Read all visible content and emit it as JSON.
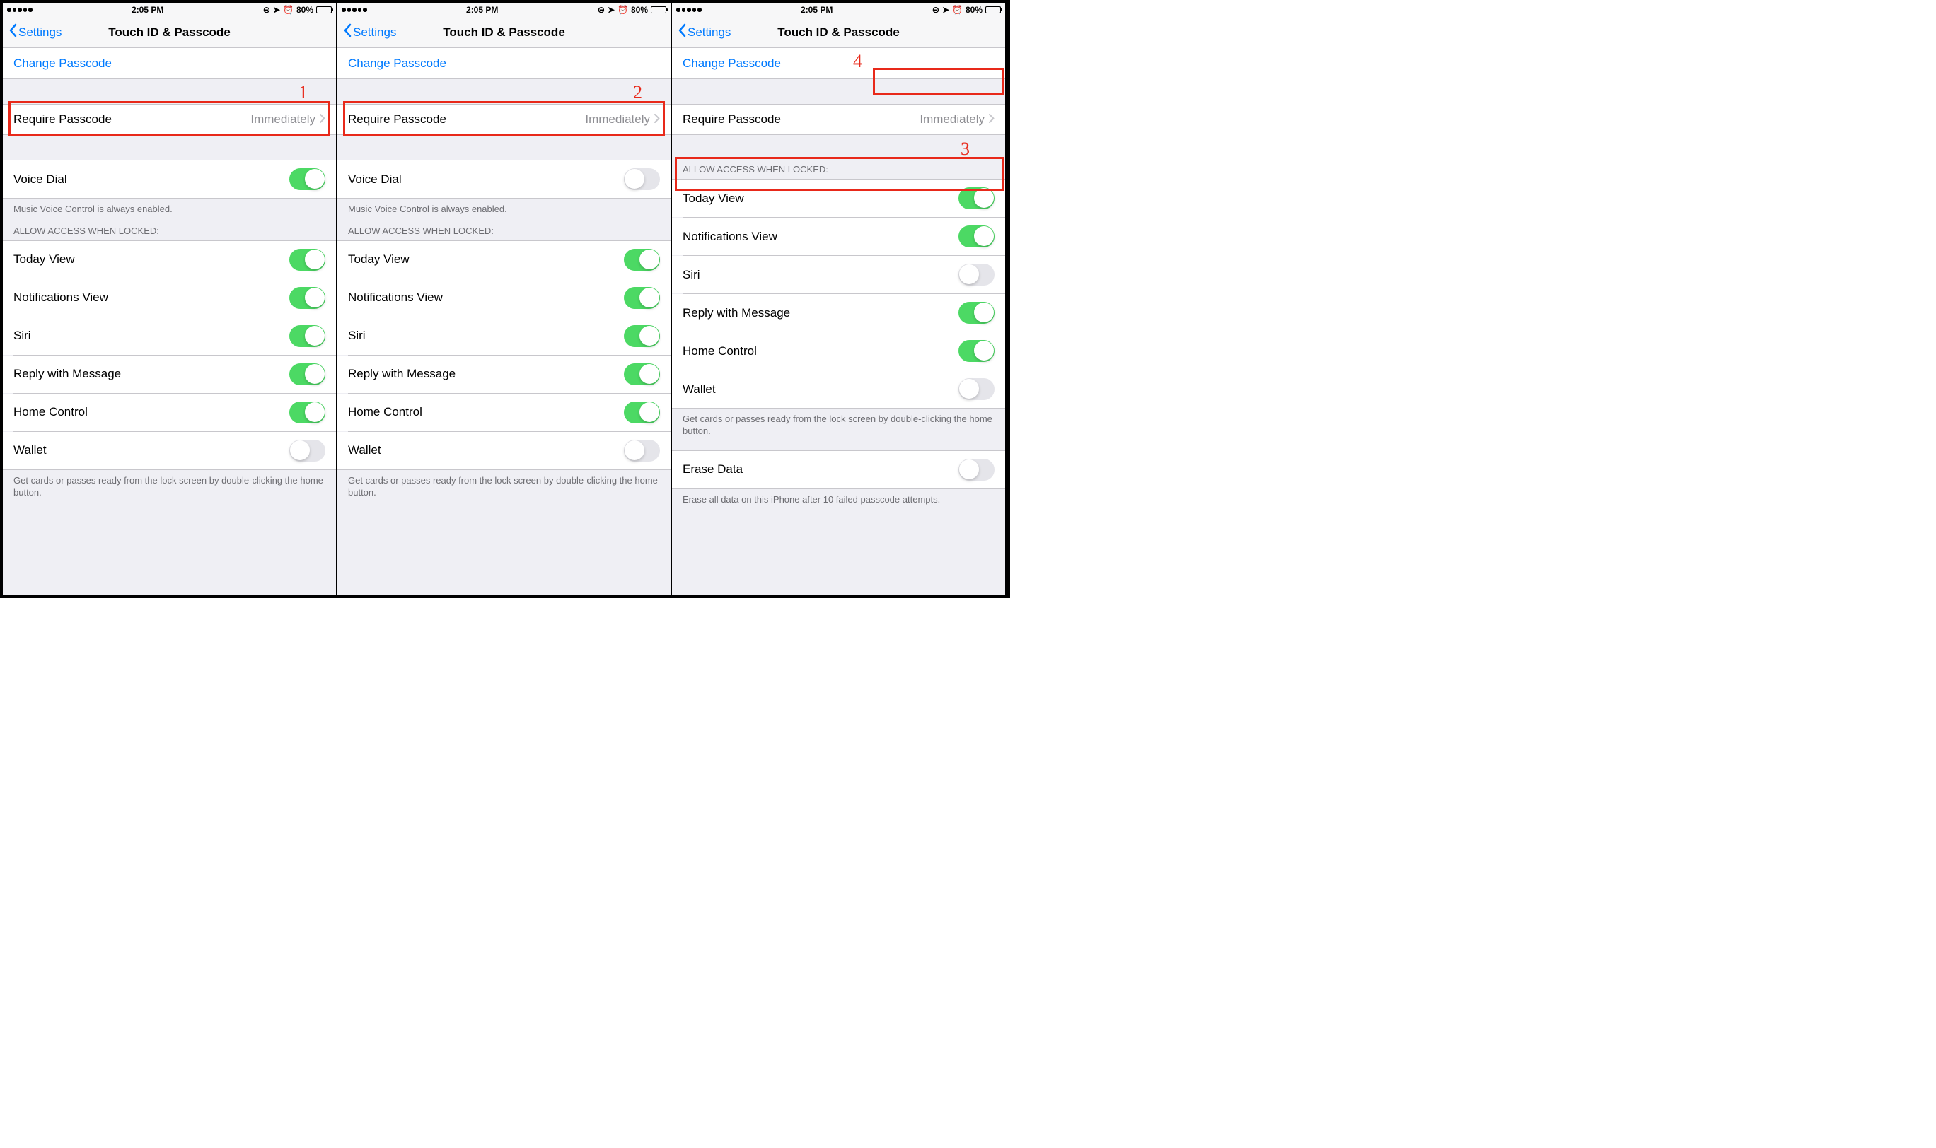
{
  "status": {
    "time": "2:05 PM",
    "battery_pct": "80%"
  },
  "nav": {
    "back_label": "Settings",
    "title": "Touch ID & Passcode"
  },
  "labels": {
    "change_passcode": "Change Passcode",
    "require_passcode": "Require Passcode",
    "require_passcode_value": "Immediately",
    "voice_dial": "Voice Dial",
    "voice_dial_footer": "Music Voice Control is always enabled.",
    "allow_access_header": "ALLOW ACCESS WHEN LOCKED:",
    "wallet_footer": "Get cards or passes ready from the lock screen by double-clicking the home button.",
    "erase_data": "Erase Data",
    "erase_data_footer": "Erase all data on this iPhone after 10 failed passcode attempts."
  },
  "access_items": [
    {
      "label": "Today View"
    },
    {
      "label": "Notifications View"
    },
    {
      "label": "Siri"
    },
    {
      "label": "Reply with Message"
    },
    {
      "label": "Home Control"
    },
    {
      "label": "Wallet"
    }
  ],
  "screens": [
    {
      "voice_dial_on": true,
      "show_voice_dial": true,
      "show_erase": false,
      "access_states": [
        true,
        true,
        true,
        true,
        true,
        false
      ],
      "callout": {
        "n": "1",
        "target": "voice-dial"
      }
    },
    {
      "voice_dial_on": false,
      "show_voice_dial": true,
      "show_erase": false,
      "access_states": [
        true,
        true,
        true,
        true,
        true,
        false
      ],
      "callout": {
        "n": "2",
        "target": "voice-dial"
      }
    },
    {
      "voice_dial_on": false,
      "show_voice_dial": false,
      "show_erase": true,
      "access_states": [
        true,
        true,
        false,
        true,
        true,
        false
      ],
      "callout_siri": {
        "n": "3"
      },
      "callout_require": {
        "n": "4"
      }
    }
  ]
}
